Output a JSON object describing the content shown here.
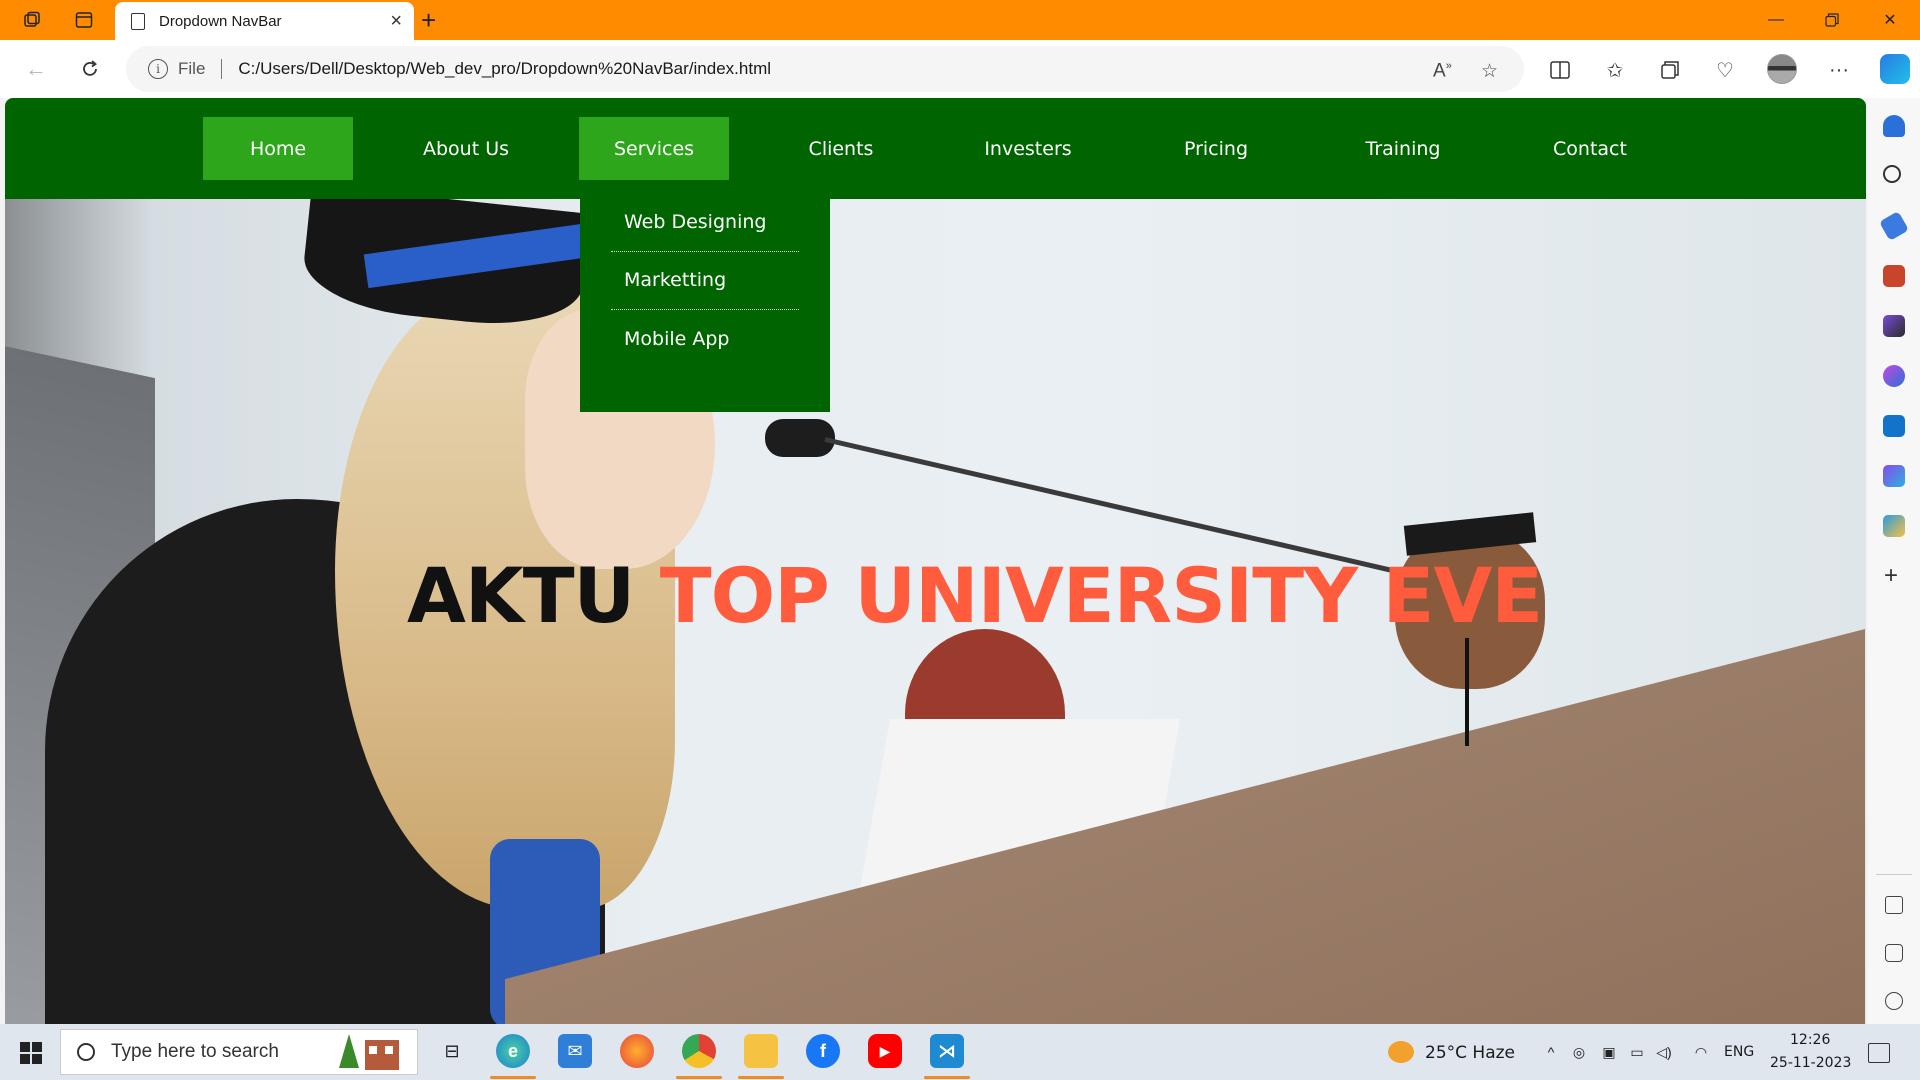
{
  "browser": {
    "tab_title": "Dropdown NavBar",
    "address_prefix": "File",
    "url": "C:/Users/Dell/Desktop/Web_dev_pro/Dropdown%20NavBar/index.html"
  },
  "nav": {
    "items": [
      {
        "label": "Home",
        "active": true
      },
      {
        "label": "About Us",
        "active": false
      },
      {
        "label": "Services",
        "active": true
      },
      {
        "label": "Clients",
        "active": false
      },
      {
        "label": "Investers",
        "active": false
      },
      {
        "label": "Pricing",
        "active": false
      },
      {
        "label": "Training",
        "active": false
      },
      {
        "label": "Contact",
        "active": false
      }
    ],
    "dropdown": [
      "Web Designing",
      "Marketting",
      "Mobile App"
    ],
    "colors": {
      "bar": "#006400",
      "active": "#2ea61c",
      "text": "#ffffff"
    }
  },
  "hero": {
    "word1": "AKTU",
    "word2": "TOP UNIVERSITY EVE",
    "word2_color": "#ff5c3e"
  },
  "taskbar": {
    "search_placeholder": "Type here to search",
    "weather": "25°C  Haze",
    "language": "ENG",
    "time": "12:26",
    "date": "25-11-2023"
  }
}
